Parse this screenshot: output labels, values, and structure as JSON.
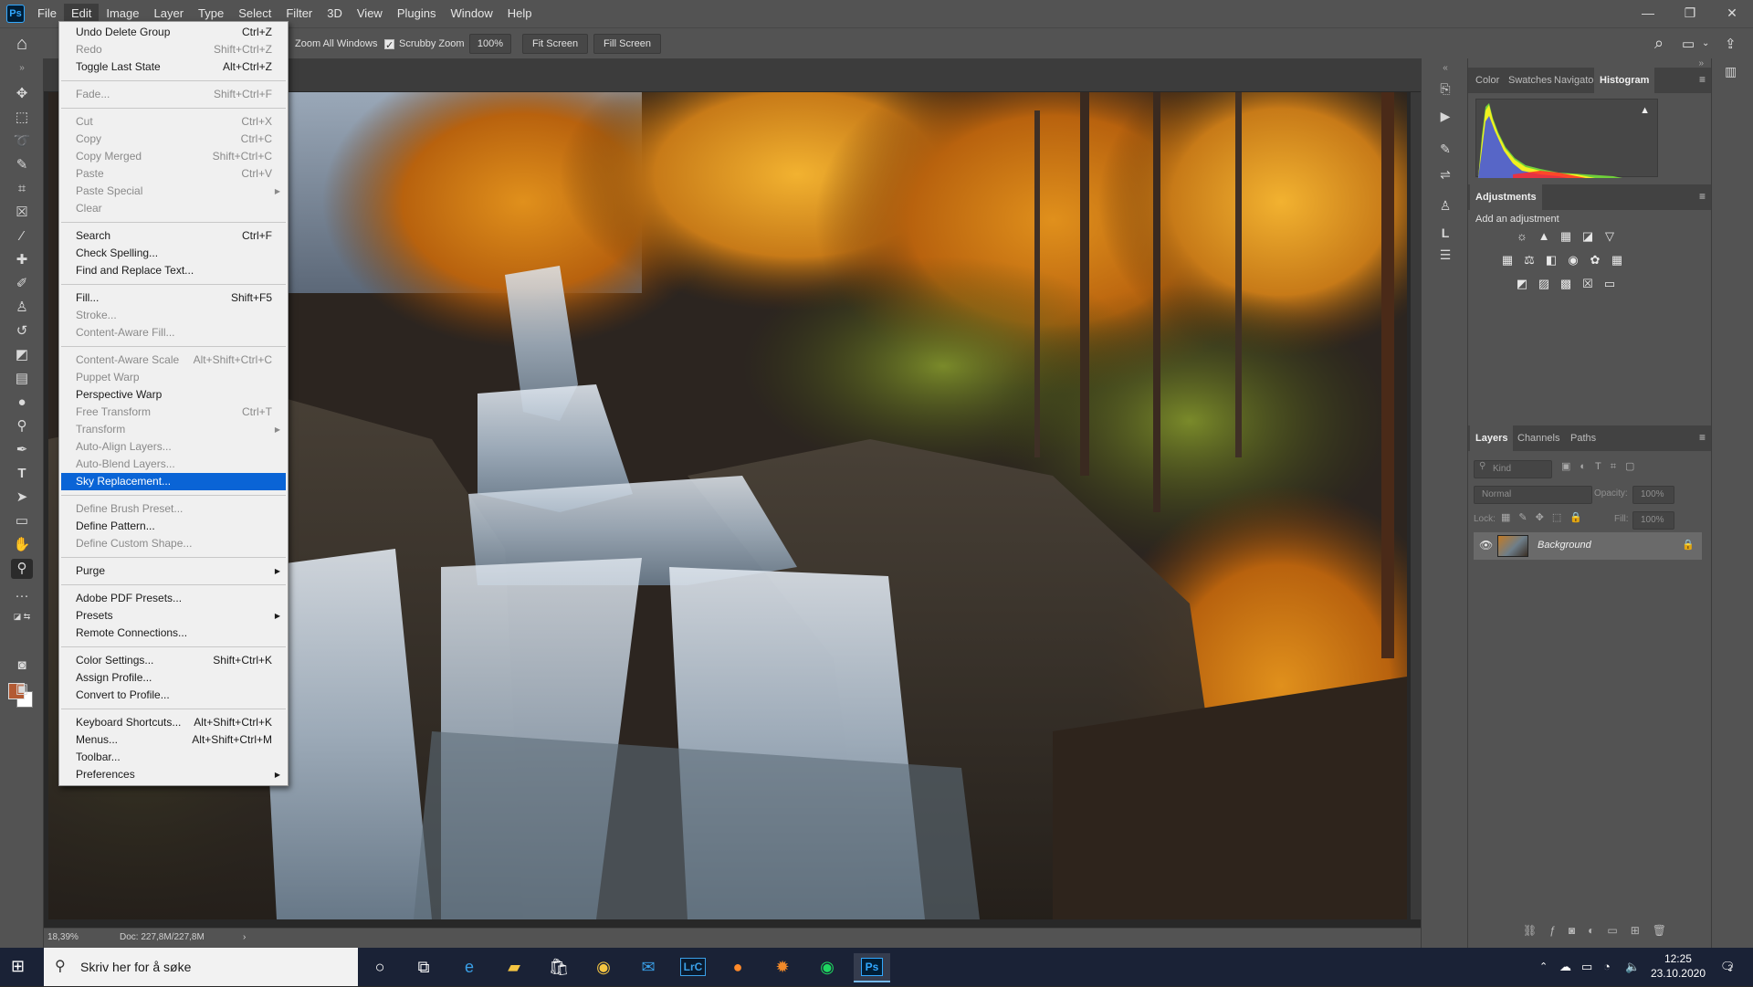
{
  "app": {
    "logo": "Ps",
    "menus": [
      "File",
      "Edit",
      "Image",
      "Layer",
      "Type",
      "Select",
      "Filter",
      "3D",
      "View",
      "Plugins",
      "Window",
      "Help"
    ],
    "active_menu": "Edit",
    "window_controls": [
      "—",
      "❐",
      "✕"
    ]
  },
  "options_bar": {
    "zoom_all_windows": "Zoom All Windows",
    "scrubby_zoom": "Scrubby Zoom",
    "zoom_value": "100%",
    "fit_screen": "Fit Screen",
    "fill_screen": "Fill Screen"
  },
  "edit_menu": [
    {
      "label": "Undo Delete Group",
      "shortcut": "Ctrl+Z",
      "enabled": true
    },
    {
      "label": "Redo",
      "shortcut": "Shift+Ctrl+Z",
      "enabled": false
    },
    {
      "label": "Toggle Last State",
      "shortcut": "Alt+Ctrl+Z",
      "enabled": true
    },
    {
      "sep": true
    },
    {
      "label": "Fade...",
      "shortcut": "Shift+Ctrl+F",
      "enabled": false
    },
    {
      "sep": true
    },
    {
      "label": "Cut",
      "shortcut": "Ctrl+X",
      "enabled": false
    },
    {
      "label": "Copy",
      "shortcut": "Ctrl+C",
      "enabled": false
    },
    {
      "label": "Copy Merged",
      "shortcut": "Shift+Ctrl+C",
      "enabled": false
    },
    {
      "label": "Paste",
      "shortcut": "Ctrl+V",
      "enabled": false
    },
    {
      "label": "Paste Special",
      "shortcut": "",
      "enabled": false,
      "submenu": true
    },
    {
      "label": "Clear",
      "shortcut": "",
      "enabled": false
    },
    {
      "sep": true
    },
    {
      "label": "Search",
      "shortcut": "Ctrl+F",
      "enabled": true
    },
    {
      "label": "Check Spelling...",
      "shortcut": "",
      "enabled": true
    },
    {
      "label": "Find and Replace Text...",
      "shortcut": "",
      "enabled": true
    },
    {
      "sep": true
    },
    {
      "label": "Fill...",
      "shortcut": "Shift+F5",
      "enabled": true
    },
    {
      "label": "Stroke...",
      "shortcut": "",
      "enabled": false
    },
    {
      "label": "Content-Aware Fill...",
      "shortcut": "",
      "enabled": false
    },
    {
      "sep": true
    },
    {
      "label": "Content-Aware Scale",
      "shortcut": "Alt+Shift+Ctrl+C",
      "enabled": false
    },
    {
      "label": "Puppet Warp",
      "shortcut": "",
      "enabled": false
    },
    {
      "label": "Perspective Warp",
      "shortcut": "",
      "enabled": true
    },
    {
      "label": "Free Transform",
      "shortcut": "Ctrl+T",
      "enabled": false
    },
    {
      "label": "Transform",
      "shortcut": "",
      "enabled": false,
      "submenu": true
    },
    {
      "label": "Auto-Align Layers...",
      "shortcut": "",
      "enabled": false
    },
    {
      "label": "Auto-Blend Layers...",
      "shortcut": "",
      "enabled": false
    },
    {
      "label": "Sky Replacement...",
      "shortcut": "",
      "enabled": true,
      "highlighted": true
    },
    {
      "sep": true
    },
    {
      "label": "Define Brush Preset...",
      "shortcut": "",
      "enabled": false
    },
    {
      "label": "Define Pattern...",
      "shortcut": "",
      "enabled": true
    },
    {
      "label": "Define Custom Shape...",
      "shortcut": "",
      "enabled": false
    },
    {
      "sep": true
    },
    {
      "label": "Purge",
      "shortcut": "",
      "enabled": true,
      "submenu": true
    },
    {
      "sep": true
    },
    {
      "label": "Adobe PDF Presets...",
      "shortcut": "",
      "enabled": true
    },
    {
      "label": "Presets",
      "shortcut": "",
      "enabled": true,
      "submenu": true
    },
    {
      "label": "Remote Connections...",
      "shortcut": "",
      "enabled": true
    },
    {
      "sep": true
    },
    {
      "label": "Color Settings...",
      "shortcut": "Shift+Ctrl+K",
      "enabled": true
    },
    {
      "label": "Assign Profile...",
      "shortcut": "",
      "enabled": true
    },
    {
      "label": "Convert to Profile...",
      "shortcut": "",
      "enabled": true
    },
    {
      "sep": true
    },
    {
      "label": "Keyboard Shortcuts...",
      "shortcut": "Alt+Shift+Ctrl+K",
      "enabled": true
    },
    {
      "label": "Menus...",
      "shortcut": "Alt+Shift+Ctrl+M",
      "enabled": true
    },
    {
      "label": "Toolbar...",
      "shortcut": "",
      "enabled": true
    },
    {
      "label": "Preferences",
      "shortcut": "",
      "enabled": true,
      "submenu": true
    }
  ],
  "status": {
    "zoom": "18,39%",
    "doc": "Doc: 227,8M/227,8M"
  },
  "panels": {
    "top_tabs": [
      "Color",
      "Swatches",
      "Navigator",
      "Histogram"
    ],
    "top_active": "Histogram",
    "adjustments_tab": "Adjustments",
    "add_adjustment": "Add an adjustment",
    "layer_tabs": [
      "Layers",
      "Channels",
      "Paths"
    ],
    "layers_active": "Layers",
    "kind_placeholder": "Kind",
    "blend_mode": "Normal",
    "opacity_label": "Opacity:",
    "opacity_value": "100%",
    "lock_label": "Lock:",
    "fill_label": "Fill:",
    "fill_value": "100%",
    "layer_name": "Background"
  },
  "taskbar": {
    "search_placeholder": "Skriv her for å søke",
    "time": "12:25",
    "date": "23.10.2020",
    "notification_count": "2",
    "apps": [
      "Cortana",
      "Task View",
      "Edge",
      "File Explorer",
      "Store",
      "Chrome",
      "Mail",
      "Lightroom Classic",
      "Firefox",
      "Ubuntu",
      "Spotify",
      "Photoshop"
    ],
    "lrc_label": "LrC",
    "ps_label": "Ps"
  },
  "colors": {
    "accent": "#0a64d6",
    "foreground_swatch": "#b35a33",
    "background_swatch": "#ffffff"
  }
}
